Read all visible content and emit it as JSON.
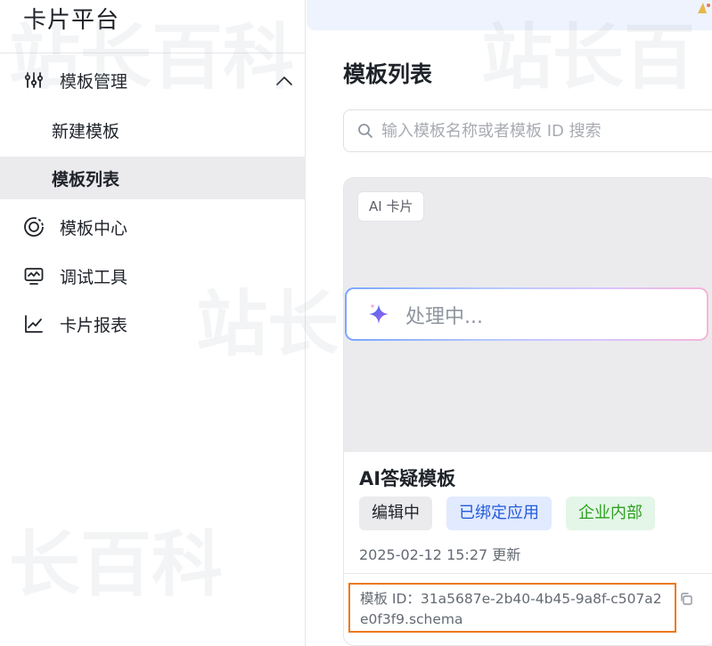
{
  "brand": {
    "title": "卡片平台"
  },
  "sidebar": {
    "items": [
      {
        "label": "模板管理",
        "icon": "sliders-icon",
        "expanded": true
      },
      {
        "label": "新建模板"
      },
      {
        "label": "模板列表",
        "active": true
      },
      {
        "label": "模板中心",
        "icon": "target-icon"
      },
      {
        "label": "调试工具",
        "icon": "monitor-icon"
      },
      {
        "label": "卡片报表",
        "icon": "chart-icon"
      }
    ]
  },
  "main": {
    "title": "模板列表",
    "search": {
      "placeholder": "输入模板名称或者模板 ID 搜索",
      "value": ""
    },
    "card": {
      "type_tag": "AI 卡片",
      "processing_text": "处理中...",
      "name": "AI答疑模板",
      "badges": [
        {
          "label": "编辑中",
          "color": "#1f2329"
        },
        {
          "label": "已绑定应用",
          "color": "#245bdb"
        },
        {
          "label": "企业内部",
          "color": "#2ea121"
        }
      ],
      "updated": "2025-02-12 15:27 更新",
      "template_id": "模板 ID：31a5687e-2b40-4b45-9a8f-c507a2e0f3f9.schema"
    }
  },
  "colors": {
    "highlight": "#ec7a1c",
    "accent": "#245bdb",
    "active_bg": "#ebebee"
  }
}
